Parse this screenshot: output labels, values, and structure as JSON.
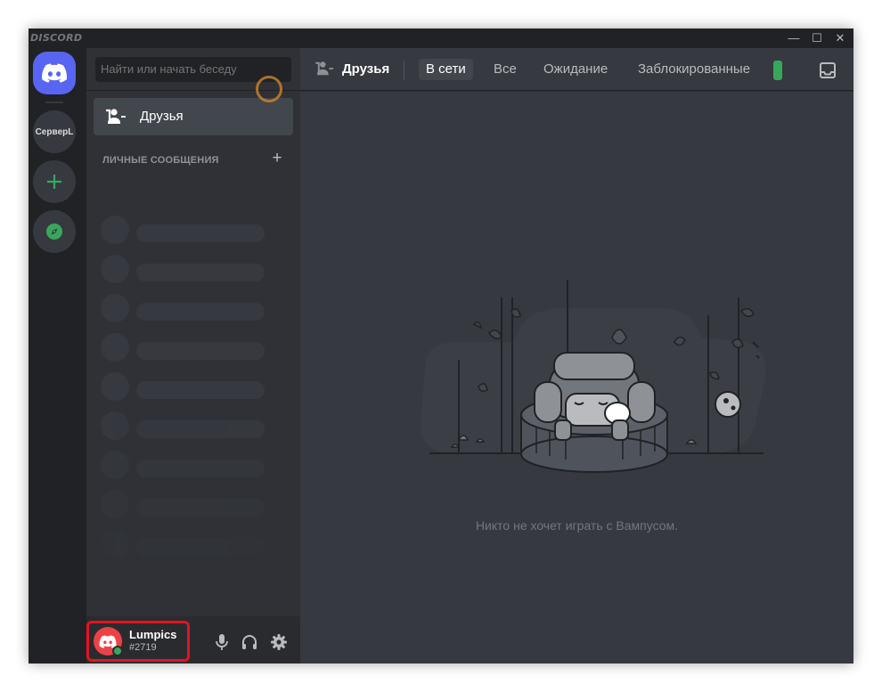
{
  "window": {
    "brand": "DISCORD",
    "controls": {
      "minimize": "—",
      "maximize": "☐",
      "close": "✕"
    }
  },
  "guilds": {
    "server_label": "CepвepL"
  },
  "sidebar": {
    "search_placeholder": "Найти или начать беседу",
    "friends_label": "Друзья",
    "dm_header": "ЛИЧНЫЕ СООБЩЕНИЯ",
    "dm_add": "+"
  },
  "user": {
    "name": "Lumpics",
    "tag": "#2719",
    "status_color": "#3ba55d"
  },
  "topbar": {
    "title": "Друзья",
    "tabs": [
      {
        "label": "В сети",
        "selected": true
      },
      {
        "label": "Все",
        "selected": false
      },
      {
        "label": "Ожидание",
        "selected": false
      },
      {
        "label": "Заблокированные",
        "selected": false
      }
    ]
  },
  "main": {
    "empty_text": "Никто не хочет играть с Вампусом."
  },
  "colors": {
    "accent": "#5865f2",
    "green": "#3ba55d",
    "highlight": "#e3141c"
  }
}
